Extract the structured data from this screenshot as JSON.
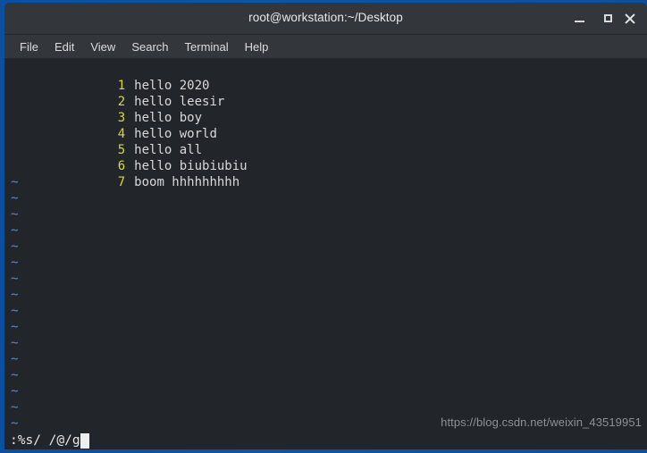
{
  "window": {
    "title": "root@workstation:~/Desktop",
    "controls": [
      {
        "name": "minimize-button",
        "label": "–",
        "icon": "minimize-icon"
      },
      {
        "name": "maximize-button",
        "label": "□",
        "icon": "maximize-icon"
      },
      {
        "name": "close-button",
        "label": "×",
        "icon": "close-icon"
      }
    ],
    "frame_color": "#0e5199",
    "titlebar_color": "#33373b"
  },
  "menubar": {
    "items": [
      {
        "label": "File"
      },
      {
        "label": "Edit"
      },
      {
        "label": "View"
      },
      {
        "label": "Search"
      },
      {
        "label": "Terminal"
      },
      {
        "label": "Help"
      }
    ]
  },
  "editor": {
    "background": "#22262a",
    "lineno_color": "#d7d73f",
    "text_color": "#d8d8d8",
    "tilde_color": "#5f87d7",
    "tilde_glyph": "~",
    "tilde_count": 16,
    "lines": [
      {
        "number": "1",
        "text": "hello 2020"
      },
      {
        "number": "2",
        "text": "hello leesir"
      },
      {
        "number": "3",
        "text": "hello boy"
      },
      {
        "number": "4",
        "text": "hello world"
      },
      {
        "number": "5",
        "text": "hello all"
      },
      {
        "number": "6",
        "text": "hello biubiubiu"
      },
      {
        "number": "7",
        "text": "boom hhhhhhhhh"
      }
    ]
  },
  "statusline": {
    "command": ":%s/ /@/g",
    "cursor": "block",
    "watermark": "https://blog.csdn.net/weixin_43519951"
  }
}
